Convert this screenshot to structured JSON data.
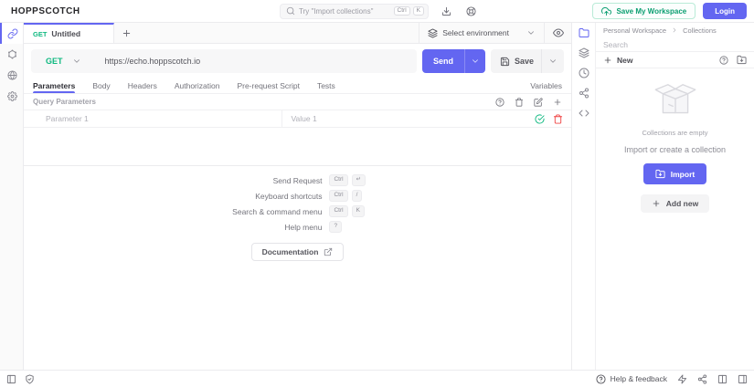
{
  "app": {
    "title": "HOPPSCOTCH"
  },
  "colors": {
    "accent": "#6366f1",
    "success": "#10b981",
    "danger": "#ef4444"
  },
  "topbar": {
    "search_placeholder": "Try \"Import collections\"",
    "search_keys": [
      "Ctrl",
      "K"
    ],
    "save_workspace_label": "Save My Workspace",
    "login_label": "Login"
  },
  "tabbar": {
    "active_tab": {
      "method": "GET",
      "title": "Untitled"
    },
    "environment_label": "Select environment"
  },
  "request": {
    "method": "GET",
    "url": "https://echo.hoppscotch.io",
    "send_label": "Send",
    "save_label": "Save"
  },
  "request_tabs": {
    "items": [
      "Parameters",
      "Body",
      "Headers",
      "Authorization",
      "Pre-request Script",
      "Tests"
    ],
    "active": "Parameters",
    "right_label": "Variables"
  },
  "params": {
    "section_title": "Query Parameters",
    "rows": [
      {
        "key_placeholder": "Parameter 1",
        "value_placeholder": "Value 1"
      }
    ]
  },
  "shortcuts": {
    "items": [
      {
        "label": "Send Request",
        "keys": [
          "Ctrl",
          "↵"
        ]
      },
      {
        "label": "Keyboard shortcuts",
        "keys": [
          "Ctrl",
          "/"
        ]
      },
      {
        "label": "Search & command menu",
        "keys": [
          "Ctrl",
          "K"
        ]
      },
      {
        "label": "Help menu",
        "keys": [
          "?"
        ]
      }
    ],
    "documentation_label": "Documentation"
  },
  "collections": {
    "breadcrumb": [
      "Personal Workspace",
      "Collections"
    ],
    "search_placeholder": "Search",
    "new_label": "New",
    "empty_title": "Collections are empty",
    "empty_subtitle": "Import or create a collection",
    "import_label": "Import",
    "add_new_label": "Add new"
  },
  "statusbar": {
    "help_label": "Help & feedback"
  },
  "icon_names": [
    "link-icon",
    "graphql-icon",
    "globe-icon",
    "gear-icon",
    "search-icon",
    "download-icon",
    "life-buoy-icon",
    "cloud-upload-icon",
    "layers-icon",
    "eye-icon",
    "chevron-down-icon",
    "save-icon",
    "help-circle-icon",
    "trash-icon",
    "edit-icon",
    "plus-icon",
    "check-circle-icon",
    "external-link-icon",
    "folder-icon",
    "clock-icon",
    "share-icon",
    "code-icon",
    "folder-import-icon",
    "empty-box-illustration",
    "panel-left-icon",
    "shield-check-icon",
    "zap-icon",
    "columns-icon",
    "panel-right-icon"
  ]
}
